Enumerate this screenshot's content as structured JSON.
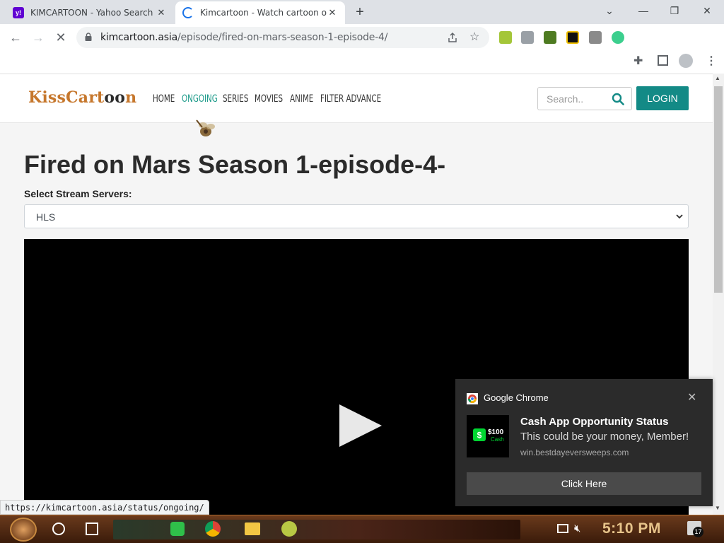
{
  "browser": {
    "tabs": [
      {
        "title": "KIMCARTOON - Yahoo Search",
        "favicon": "yahoo-icon",
        "active": false
      },
      {
        "title": "Kimcartoon - Watch cartoon online",
        "favicon": "loading-spinner",
        "active": true
      }
    ],
    "url_host": "kimcartoon.asia",
    "url_path": "/episode/fired-on-mars-season-1-episode-4/",
    "status_url": "https://kimcartoon.asia/status/ongoing/"
  },
  "site": {
    "logo": {
      "prefix": "KissCart",
      "middle": "oo",
      "suffix": "n"
    },
    "nav": [
      "HOME",
      "ONGOING",
      "SERIES",
      "MOVIES",
      "ANIME",
      "FILTER ADVANCE"
    ],
    "active_nav": "ONGOING",
    "search_placeholder": "Search..",
    "login_label": "LOGIN",
    "accent_color": "#138a86"
  },
  "main": {
    "title": "Fired on Mars Season 1-episode-4-",
    "server_label": "Select Stream Servers:",
    "server_selected": "HLS"
  },
  "notification": {
    "app": "Google Chrome",
    "title": "Cash App Opportunity Status",
    "body": "This could be your money, Member!",
    "source": "win.bestdayeversweeps.com",
    "thumb_amount": "$100",
    "thumb_label": "Cash",
    "button": "Click Here"
  },
  "taskbar": {
    "clock": "5:10 PM",
    "notification_count": "17"
  }
}
